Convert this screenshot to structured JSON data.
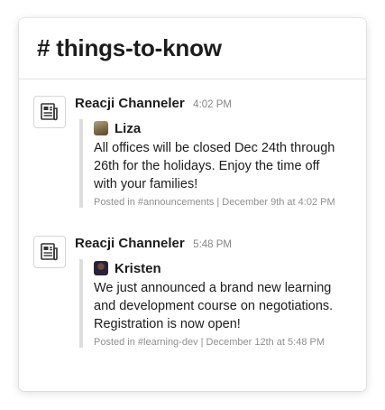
{
  "channel": {
    "title": "# things-to-know"
  },
  "messages": [
    {
      "sender": "Reacji Channeler",
      "time": "4:02 PM",
      "app_icon": "newspaper-icon",
      "attachment": {
        "author": "Liza",
        "author_avatar_color": "#8a7a5c",
        "text": "All offices will be closed Dec 24th through 26th for the holidays. Enjoy the time off with your families!",
        "footer": "Posted in #announcements | December 9th at 4:02 PM"
      }
    },
    {
      "sender": "Reacji Channeler",
      "time": "5:48 PM",
      "app_icon": "newspaper-icon",
      "attachment": {
        "author": "Kristen",
        "author_avatar_color": "#3a2d4a",
        "text": "We just announced a brand new learning and development course on negotiations. Registration is now open!",
        "footer": "Posted in #learning-dev | December 12th at 5:48 PM"
      }
    }
  ],
  "colors": {
    "attachment_bar": "#dddddd",
    "muted_text": "#868686"
  }
}
